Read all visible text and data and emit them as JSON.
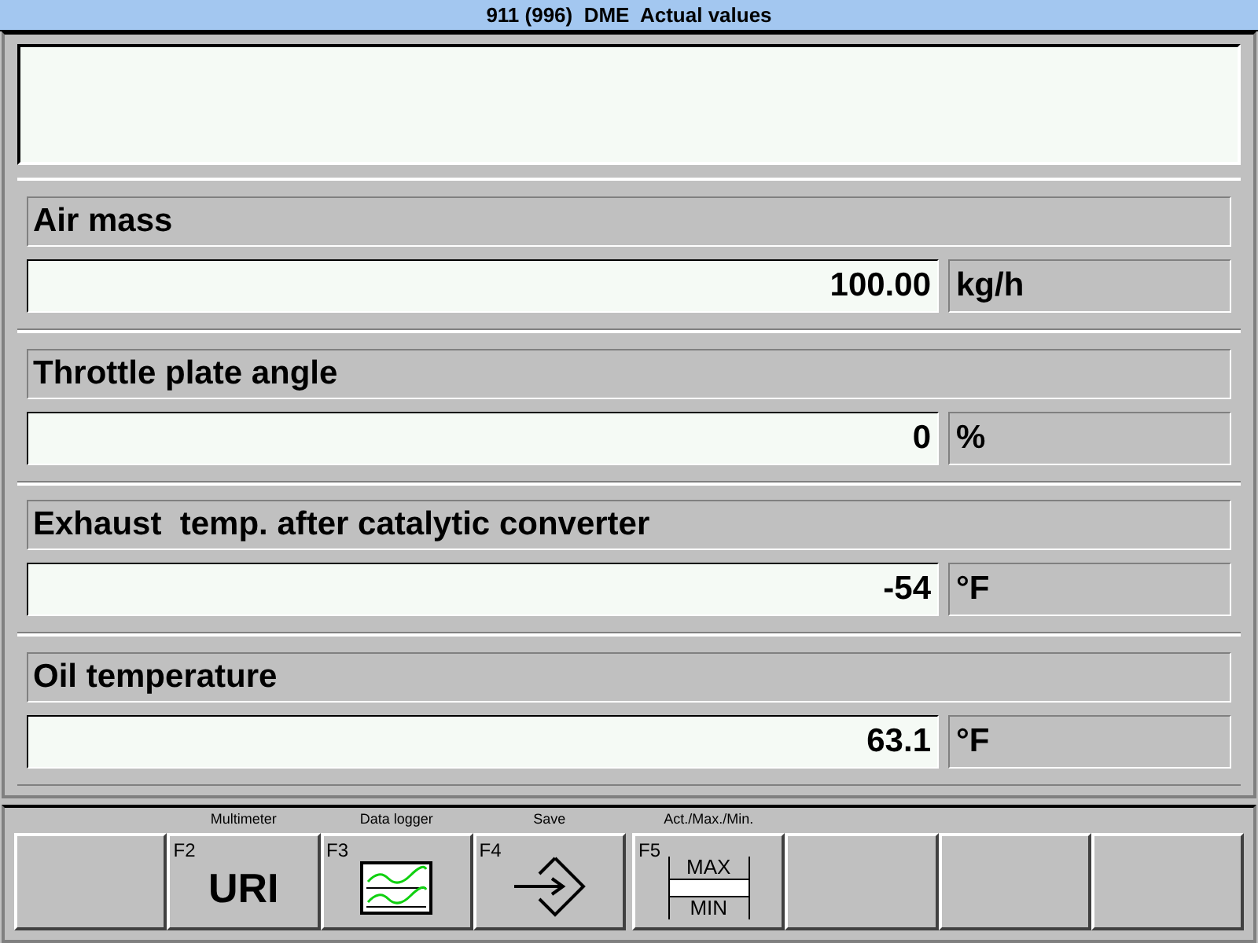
{
  "window": {
    "title": "911 (996)  DME  Actual values"
  },
  "values": [
    {
      "name": "Air mass",
      "value": "100.00",
      "unit": "kg/h"
    },
    {
      "name": "Throttle plate angle",
      "value": "0",
      "unit": "%"
    },
    {
      "name": "Exhaust  temp. after catalytic converter",
      "value": "-54",
      "unit": "°F"
    },
    {
      "name": "Oil temperature",
      "value": "63.1",
      "unit": "°F"
    }
  ],
  "function_keys": [
    {
      "kind": "empty"
    },
    {
      "kind": "text",
      "key": "F2",
      "caption": "Multimeter",
      "text": "URI"
    },
    {
      "kind": "chart",
      "key": "F3",
      "caption": "Data logger"
    },
    {
      "kind": "save",
      "key": "F4",
      "caption": "Save"
    },
    {
      "kind": "maxmin",
      "key": "F5",
      "caption": "Act./Max./Min.",
      "top": "MAX",
      "bottom": "MIN"
    },
    {
      "kind": "empty"
    },
    {
      "kind": "empty"
    },
    {
      "kind": "empty"
    }
  ]
}
